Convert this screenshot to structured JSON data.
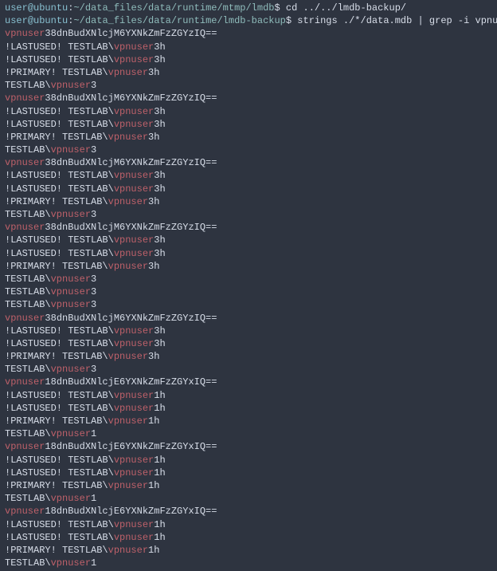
{
  "prompt": {
    "user": "user",
    "at": "@",
    "host": "ubuntu",
    "colon": ":",
    "path_full": "~/data_files/data/runtime/mtmp/lmdb",
    "path_backup": "~/data_files/data/runtime/lmdb-backup",
    "dollar": "$ "
  },
  "commands": {
    "cd_cmd": "cd ../../lmdb-backup/",
    "strings_cmd": "strings ./*/data.mdb | grep -i vpnuser"
  },
  "match_token": "vpnuser",
  "encoded3": "38dnBudXNlcjM6YXNkZmFzZGYzIQ==",
  "encoded1": "18dnBudXNlcjE6YXNkZmFzZGYxIQ==",
  "lines": {
    "lastused_prefix": "!LASTUSED! TESTLAB\\",
    "primary_prefix": "!PRIMARY! TESTLAB\\",
    "testlab_prefix": "TESTLAB\\",
    "suffix3h": "3h",
    "suffix1h": "1h",
    "suffix3": "3",
    "suffix1": "1"
  }
}
